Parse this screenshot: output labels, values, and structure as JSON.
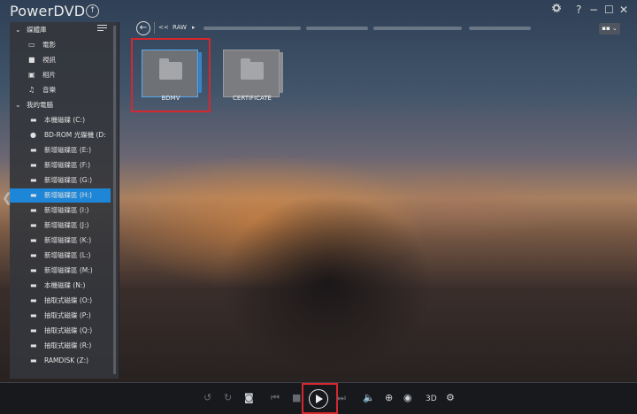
{
  "app": {
    "title": "PowerDVD"
  },
  "window_controls": {
    "settings": "⚙",
    "help": "?",
    "minimize": "−",
    "maximize": "☐",
    "close": "✕"
  },
  "sidebar": {
    "media_library": "媒體庫",
    "movies": "電影",
    "videos": "視訊",
    "photos": "相片",
    "music": "音樂",
    "my_computer": "我的電腦",
    "drives": [
      "本機磁碟 (C:)",
      "BD-ROM 光碟機 (D:",
      "新增磁碟區 (E:)",
      "新增磁碟區 (F:)",
      "新增磁碟區 (G:)",
      "新增磁碟區 (H:)",
      "新增磁碟區 (I:)",
      "新增磁碟區 (J:)",
      "新增磁碟區 (K:)",
      "新增磁碟區 (L:)",
      "新增磁碟區 (M:)",
      "本機磁碟 (N:)",
      "抽取式磁碟 (O:)",
      "抽取式磁碟 (P:)",
      "抽取式磁碟 (Q:)",
      "抽取式磁碟 (R:)",
      "RAMDISK (Z:)"
    ],
    "selected_drive": "新增磁碟區 (H:)"
  },
  "breadcrumb": {
    "prefix": "<<",
    "folder": "RAW",
    "arrow": "▸"
  },
  "files": [
    {
      "name": "BDMV",
      "highlighted": true
    },
    {
      "name": "CERTIFICATE",
      "highlighted": false
    }
  ],
  "playback": {
    "three_d": "3D"
  },
  "colors": {
    "selection": "#1e86d6",
    "highlight_box": "#d6262e"
  }
}
